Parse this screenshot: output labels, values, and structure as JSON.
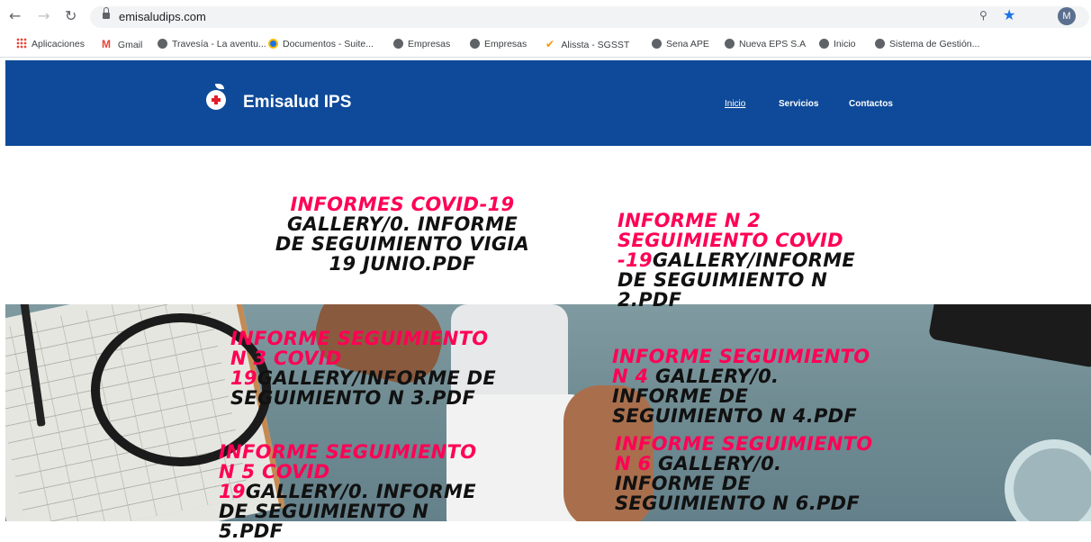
{
  "browser": {
    "url": "emisaludips.com",
    "avatar_letter": "M",
    "bookmarks": [
      {
        "label": "Aplicaciones",
        "icon": "apps-grid-icon"
      },
      {
        "label": "Gmail",
        "icon": "gmail-icon"
      },
      {
        "label": "Travesía - La aventu...",
        "icon": "globe-icon"
      },
      {
        "label": "Documentos - Suite...",
        "icon": "drive-icon"
      },
      {
        "label": "Empresas",
        "icon": "globe-icon"
      },
      {
        "label": "Empresas",
        "icon": "globe-icon"
      },
      {
        "label": "Alissta - SGSST",
        "icon": "alissta-icon"
      },
      {
        "label": "Sena APE",
        "icon": "globe-icon"
      },
      {
        "label": "Nueva EPS S.A",
        "icon": "globe-icon"
      },
      {
        "label": "Inicio",
        "icon": "globe-icon"
      },
      {
        "label": "Sistema de Gestión...",
        "icon": "globe-icon"
      }
    ]
  },
  "site": {
    "brand": "Emisalud IPS",
    "nav": [
      {
        "label": "Inicio",
        "active": true
      },
      {
        "label": "Servicios",
        "active": false
      },
      {
        "label": "Contactos",
        "active": false
      }
    ],
    "colors": {
      "header_bg": "#0e4a99",
      "accent_red": "#ff0055"
    }
  },
  "links": [
    {
      "red": "INFORMES COVID-19",
      "black": "GALLERY/0. INFORME DE SEGUIMIENTO VIGIA 19 JUNIO.PDF"
    },
    {
      "red": "INFORME N 2 SEGUIMIENTO COVID -19",
      "black": "GALLERY/INFORME DE SEGUIMIENTO N 2.PDF"
    },
    {
      "red": "INFORME SEGUIMIENTO N 3 COVID 19",
      "black": "GALLERY/INFORME DE SEGUIMIENTO N 3.PDF"
    },
    {
      "red": "INFORME SEGUIMIENTO N 4",
      "black": " GALLERY/0. INFORME DE SEGUIMIENTO N 4.PDF"
    },
    {
      "red": "INFORME SEGUIMIENTO N 5 COVID 19",
      "black": "GALLERY/0. INFORME DE SEGUIMIENTO N 5.PDF"
    },
    {
      "red": "INFORME SEGUIMIENTO N 6",
      "black": " GALLERY/0. INFORME DE SEGUIMIENTO N 6.PDF"
    }
  ]
}
